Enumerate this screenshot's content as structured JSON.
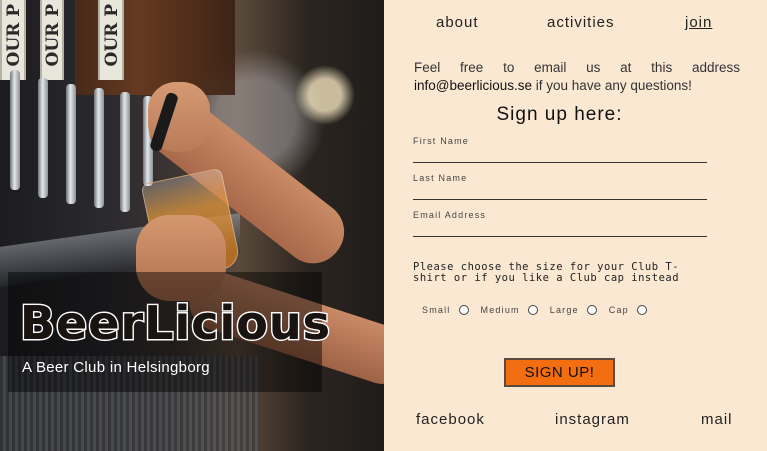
{
  "nav": {
    "about": "about",
    "activities": "activities",
    "join": "join"
  },
  "hero": {
    "title": "BeerLicious",
    "subtitle": "A Beer Club in Helsingborg",
    "tap_text": "OUR P"
  },
  "intro": {
    "text": "Feel free to email us at this address",
    "email": "info@beerlicious.se",
    "text_after": "if you have any questions!"
  },
  "form": {
    "heading": "Sign up here:",
    "first_name_label": "First Name",
    "last_name_label": "Last Name",
    "email_label": "Email Address",
    "question": "Please choose the size for your Club T-shirt or if you like a Club cap instead",
    "options": [
      "Small",
      "Medium",
      "Large",
      "Cap"
    ],
    "submit_label": "SIGN UP!"
  },
  "footer": {
    "facebook": "facebook",
    "instagram": "instagram",
    "mail": "mail"
  },
  "colors": {
    "panel_bg": "#fbe8d3",
    "button_bg": "#f26e10"
  }
}
